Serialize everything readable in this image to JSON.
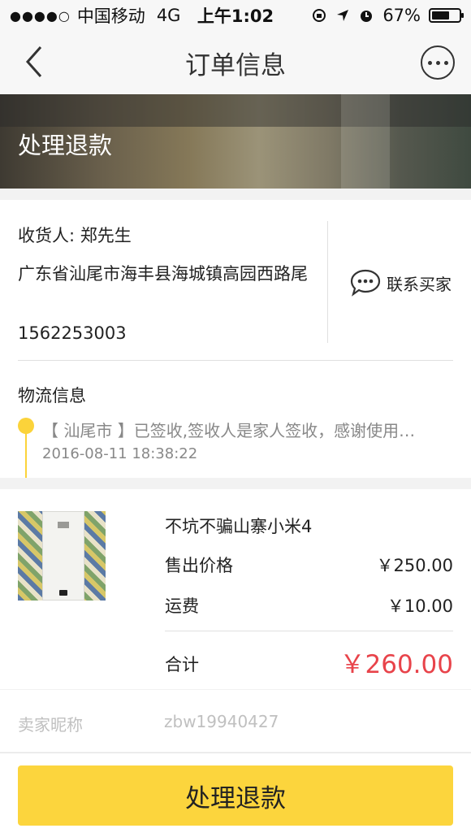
{
  "status_bar": {
    "signal": "●●●●○",
    "carrier": "中国移动",
    "network": "4G",
    "time": "上午1:02",
    "battery": "67%",
    "battery_level": 0.67
  },
  "nav": {
    "title": "订单信息"
  },
  "banner": {
    "title": "处理退款"
  },
  "buyer": {
    "name": "收货人: 郑先生",
    "address": "广东省汕尾市海丰县海城镇高园西路尾",
    "phone": "1562253003"
  },
  "contact": {
    "label": "联系买家"
  },
  "logistics": {
    "title": "物流信息",
    "text": "【 汕尾市 】已签收,签收人是家人签收，感谢使用…",
    "time": "2016-08-11 18:38:22"
  },
  "product": {
    "name": "不坑不骗山寨小米4",
    "sale_price_label": "售出价格",
    "sale_price": "￥250.00",
    "shipping_label": "运费",
    "shipping": "￥10.00",
    "total_label": "合计",
    "total": "￥260.00"
  },
  "seller": {
    "label": "卖家昵称",
    "value": "zbw19940427"
  },
  "action": {
    "label": "处理退款"
  },
  "colors": {
    "accent": "#fcd53d",
    "price_red": "#e8434a"
  }
}
